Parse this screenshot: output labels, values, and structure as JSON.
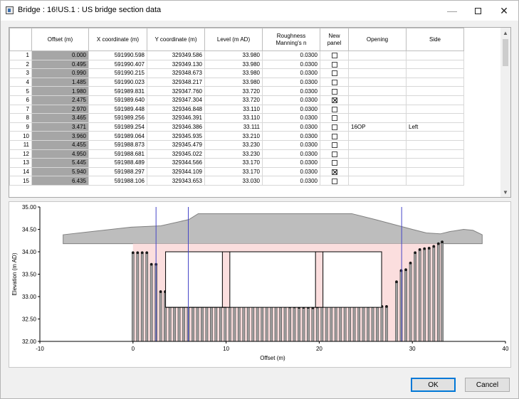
{
  "window": {
    "title": "Bridge : 16!US.1 : US bridge section data",
    "minimize": "—",
    "close": "✕"
  },
  "table": {
    "columns": [
      "",
      "Offset (m)",
      "X coordinate (m)",
      "Y coordinate (m)",
      "Level (m AD)",
      "Roughness Manning's n",
      "New panel",
      "Opening",
      "Side"
    ],
    "rows": [
      {
        "n": "1",
        "offset": "0.000",
        "x": "591990.598",
        "y": "329349.586",
        "level": "33.980",
        "rough": "0.0300",
        "panel": false,
        "opening": "",
        "side": ""
      },
      {
        "n": "2",
        "offset": "0.495",
        "x": "591990.407",
        "y": "329349.130",
        "level": "33.980",
        "rough": "0.0300",
        "panel": false,
        "opening": "",
        "side": ""
      },
      {
        "n": "3",
        "offset": "0.990",
        "x": "591990.215",
        "y": "329348.673",
        "level": "33.980",
        "rough": "0.0300",
        "panel": false,
        "opening": "",
        "side": ""
      },
      {
        "n": "4",
        "offset": "1.485",
        "x": "591990.023",
        "y": "329348.217",
        "level": "33.980",
        "rough": "0.0300",
        "panel": false,
        "opening": "",
        "side": ""
      },
      {
        "n": "5",
        "offset": "1.980",
        "x": "591989.831",
        "y": "329347.760",
        "level": "33.720",
        "rough": "0.0300",
        "panel": false,
        "opening": "",
        "side": ""
      },
      {
        "n": "6",
        "offset": "2.475",
        "x": "591989.640",
        "y": "329347.304",
        "level": "33.720",
        "rough": "0.0300",
        "panel": true,
        "opening": "",
        "side": ""
      },
      {
        "n": "7",
        "offset": "2.970",
        "x": "591989.448",
        "y": "329346.848",
        "level": "33.110",
        "rough": "0.0300",
        "panel": false,
        "opening": "",
        "side": ""
      },
      {
        "n": "8",
        "offset": "3.465",
        "x": "591989.256",
        "y": "329346.391",
        "level": "33.110",
        "rough": "0.0300",
        "panel": false,
        "opening": "",
        "side": ""
      },
      {
        "n": "9",
        "offset": "3.471",
        "x": "591989.254",
        "y": "329346.386",
        "level": "33.111",
        "rough": "0.0300",
        "panel": false,
        "opening": "16OP",
        "side": "Left"
      },
      {
        "n": "10",
        "offset": "3.960",
        "x": "591989.064",
        "y": "329345.935",
        "level": "33.210",
        "rough": "0.0300",
        "panel": false,
        "opening": "",
        "side": ""
      },
      {
        "n": "11",
        "offset": "4.455",
        "x": "591988.873",
        "y": "329345.479",
        "level": "33.230",
        "rough": "0.0300",
        "panel": false,
        "opening": "",
        "side": ""
      },
      {
        "n": "12",
        "offset": "4.950",
        "x": "591988.681",
        "y": "329345.022",
        "level": "33.230",
        "rough": "0.0300",
        "panel": false,
        "opening": "",
        "side": ""
      },
      {
        "n": "13",
        "offset": "5.445",
        "x": "591988.489",
        "y": "329344.566",
        "level": "33.170",
        "rough": "0.0300",
        "panel": false,
        "opening": "",
        "side": ""
      },
      {
        "n": "14",
        "offset": "5.940",
        "x": "591988.297",
        "y": "329344.109",
        "level": "33.170",
        "rough": "0.0300",
        "panel": true,
        "opening": "",
        "side": ""
      },
      {
        "n": "15",
        "offset": "6.435",
        "x": "591988.106",
        "y": "329343.653",
        "level": "33.030",
        "rough": "0.0300",
        "panel": false,
        "opening": "",
        "side": ""
      }
    ]
  },
  "scroll": {
    "up": "▲",
    "down": "▼"
  },
  "chart_data": {
    "type": "bar",
    "xlabel": "Offset (m)",
    "ylabel": "Elevation (m AD)",
    "xlim": [
      -10,
      40
    ],
    "ylim": [
      32.0,
      35.0
    ],
    "xticks": [
      "-10",
      "0",
      "10",
      "20",
      "30",
      "40"
    ],
    "yticks": [
      "32.00",
      "32.50",
      "33.00",
      "33.50",
      "34.00",
      "34.50",
      "35.00"
    ],
    "ground_levels": [
      [
        0.0,
        33.98
      ],
      [
        0.495,
        33.98
      ],
      [
        0.99,
        33.98
      ],
      [
        1.485,
        33.98
      ],
      [
        1.98,
        33.72
      ],
      [
        2.475,
        33.72
      ],
      [
        2.97,
        33.11
      ],
      [
        3.465,
        33.11
      ],
      [
        3.471,
        33.111
      ],
      [
        3.96,
        33.21
      ],
      [
        4.455,
        33.23
      ],
      [
        4.95,
        33.23
      ],
      [
        5.445,
        33.17
      ],
      [
        5.94,
        33.17
      ],
      [
        6.435,
        33.03
      ],
      [
        6.93,
        32.85
      ],
      [
        7.43,
        32.82
      ],
      [
        7.92,
        32.83
      ],
      [
        8.42,
        32.85
      ],
      [
        8.91,
        32.84
      ],
      [
        9.41,
        32.86
      ],
      [
        9.9,
        32.84
      ],
      [
        10.4,
        32.86
      ],
      [
        10.9,
        32.86
      ],
      [
        11.39,
        32.88
      ],
      [
        11.89,
        32.82
      ],
      [
        12.38,
        32.8
      ],
      [
        12.88,
        32.8
      ],
      [
        13.37,
        32.8
      ],
      [
        13.87,
        32.79
      ],
      [
        14.36,
        32.8
      ],
      [
        14.86,
        32.79
      ],
      [
        15.35,
        32.79
      ],
      [
        15.85,
        32.78
      ],
      [
        16.34,
        32.78
      ],
      [
        16.84,
        32.77
      ],
      [
        17.33,
        32.77
      ],
      [
        17.83,
        32.76
      ],
      [
        18.32,
        32.76
      ],
      [
        18.82,
        32.76
      ],
      [
        19.31,
        32.75
      ],
      [
        19.8,
        32.77
      ],
      [
        20.3,
        32.8
      ],
      [
        20.79,
        32.82
      ],
      [
        21.29,
        32.84
      ],
      [
        21.78,
        32.85
      ],
      [
        22.28,
        32.86
      ],
      [
        22.77,
        32.86
      ],
      [
        23.27,
        32.84
      ],
      [
        23.76,
        32.82
      ],
      [
        24.26,
        32.8
      ],
      [
        24.75,
        32.79
      ],
      [
        25.25,
        32.78
      ],
      [
        25.74,
        32.78
      ],
      [
        26.24,
        32.78
      ],
      [
        26.73,
        32.78
      ],
      [
        27.23,
        32.78
      ],
      [
        28.3,
        33.33
      ],
      [
        28.8,
        33.58
      ],
      [
        29.3,
        33.6
      ],
      [
        29.8,
        33.75
      ],
      [
        30.3,
        33.98
      ],
      [
        30.8,
        34.05
      ],
      [
        31.3,
        34.07
      ],
      [
        31.8,
        34.08
      ],
      [
        32.3,
        34.12
      ],
      [
        32.8,
        34.18
      ],
      [
        33.2,
        34.22
      ]
    ],
    "deck_top": [
      [
        -7.5,
        34.38
      ],
      [
        -0.2,
        34.55
      ],
      [
        3,
        34.58
      ],
      [
        6,
        34.72
      ],
      [
        7,
        34.85
      ],
      [
        18,
        34.85
      ],
      [
        23.5,
        34.85
      ],
      [
        26,
        34.72
      ],
      [
        30,
        34.5
      ],
      [
        31.5,
        34.42
      ],
      [
        33,
        34.4
      ],
      [
        34,
        34.45
      ],
      [
        35.5,
        34.5
      ],
      [
        36.5,
        34.48
      ],
      [
        37.5,
        34.38
      ]
    ],
    "deck_soffit": 34.18,
    "opening_extent": [
      0,
      33.2
    ],
    "opening_box": {
      "x": [
        3.5,
        26.7
      ],
      "bottom": 32.76,
      "top": 34.0
    },
    "piers": [
      [
        9.6,
        10.4
      ],
      [
        19.6,
        20.4
      ]
    ],
    "panel_markers": [
      2.475,
      5.94,
      28.85
    ]
  },
  "buttons": {
    "ok": "OK",
    "cancel": "Cancel"
  }
}
